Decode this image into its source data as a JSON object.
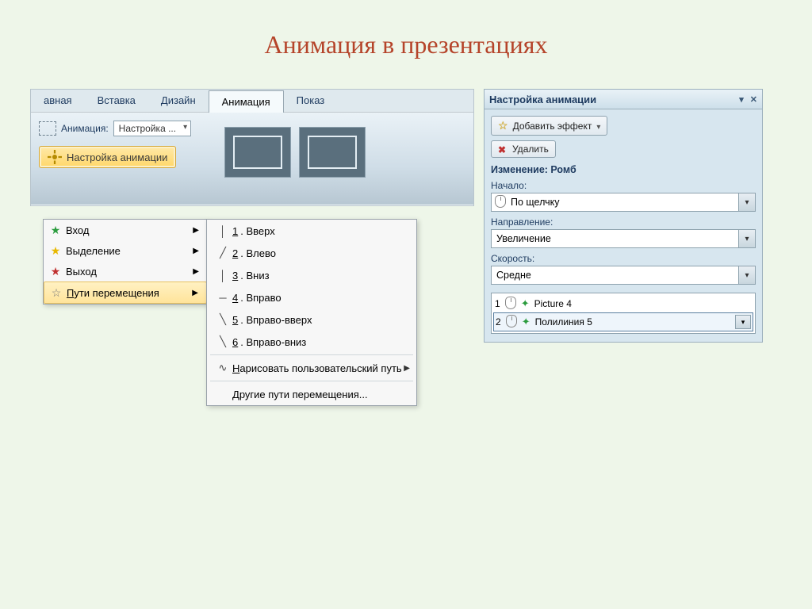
{
  "title": "Анимация в презентациях",
  "ribbon": {
    "tabs": [
      "авная",
      "Вставка",
      "Дизайн",
      "Анимация",
      "Показ"
    ],
    "active_index": 3,
    "animation_label": "Анимация:",
    "animation_value": "Настройка ...",
    "settings_button": "Настройка анимации"
  },
  "effect_menu": {
    "items": [
      {
        "label": "Вход",
        "star_color": "#2b9c3e"
      },
      {
        "label": "Выделение",
        "star_color": "#e8b800"
      },
      {
        "label": "Выход",
        "star_color": "#c03030"
      },
      {
        "label": "Пути перемещения",
        "star_color": "#888"
      }
    ],
    "selected_index": 3
  },
  "submenu": {
    "items": [
      {
        "glyph": "│",
        "num": "1",
        "label": "Вверх"
      },
      {
        "glyph": "╱",
        "num": "2",
        "label": "Влево"
      },
      {
        "glyph": "│",
        "num": "3",
        "label": "Вниз"
      },
      {
        "glyph": "─",
        "num": "4",
        "label": "Вправо"
      },
      {
        "glyph": "╲",
        "num": "5",
        "label": "Вправо-вверх"
      },
      {
        "glyph": "╲",
        "num": "6",
        "label": "Вправо-вниз"
      }
    ],
    "custom_path": "Нарисовать пользовательский путь",
    "custom_glyph": "∿",
    "more_paths": "Другие пути перемещения..."
  },
  "pane": {
    "title": "Настройка анимации",
    "add_effect": "Добавить эффект",
    "remove": "Удалить",
    "change_label": "Изменение: Ромб",
    "start_label": "Начало:",
    "start_value": "По щелчку",
    "direction_label": "Направление:",
    "direction_value": "Увеличение",
    "speed_label": "Скорость:",
    "speed_value": "Средне",
    "list": [
      {
        "order": "1",
        "name": "Picture 4"
      },
      {
        "order": "2",
        "name": "Полилиния 5"
      }
    ],
    "selected_index": 1
  }
}
